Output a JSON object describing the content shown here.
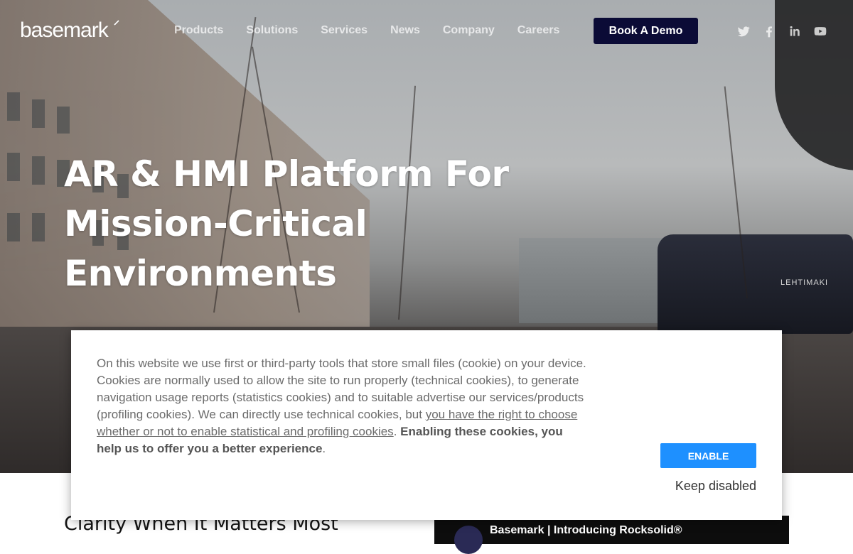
{
  "brand": {
    "logo_text": "basemark",
    "accent": "#0b0b36"
  },
  "nav": {
    "items": [
      {
        "label": "Products"
      },
      {
        "label": "Solutions"
      },
      {
        "label": "Services"
      },
      {
        "label": "News"
      },
      {
        "label": "Company"
      },
      {
        "label": "Careers"
      }
    ],
    "cta": "Book A Demo",
    "social": [
      "twitter-icon",
      "facebook-icon",
      "linkedin-icon",
      "youtube-icon"
    ]
  },
  "hero": {
    "title": "AR & HMI Platform For Mission-Critical Environments",
    "bus_label": "LEHTIMAKI"
  },
  "section": {
    "heading": "Clarity When It Matters Most",
    "video_title": "Basemark | Introducing Rocksolid®"
  },
  "cookie": {
    "text_1": "On this website we use first or third-party tools that store small files (cookie) on your device. Cookies are normally used to allow the site to run properly (technical cookies), to generate navigation usage reports (statistics cookies) and to suitable advertise our services/products (profiling cookies). We can directly use technical cookies, but ",
    "link": "you have the right to choose whether or not to enable statistical and profiling cookies",
    "text_2": ". ",
    "bold": "Enabling these cookies, you help us to offer you a better experience",
    "text_3": ".",
    "enable_label": "ENABLE",
    "keep_label": "Keep disabled",
    "enable_color": "#1e90ff"
  }
}
